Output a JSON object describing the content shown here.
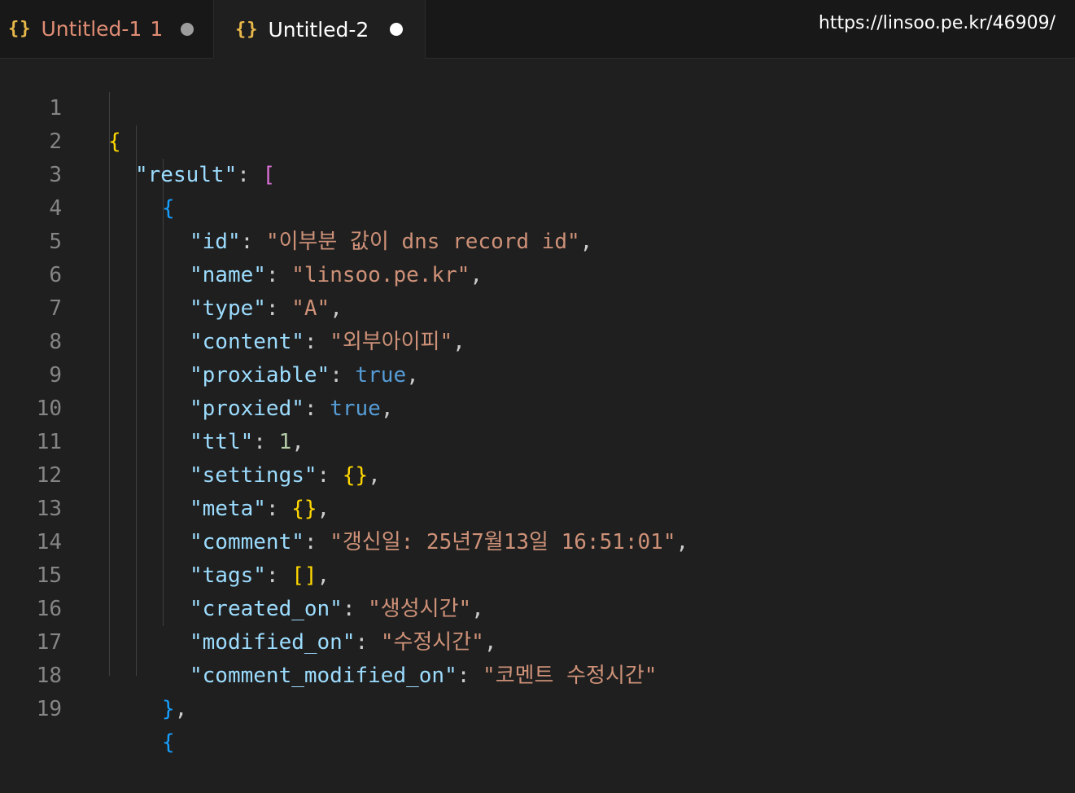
{
  "tabs": [
    {
      "icon": "{}",
      "label": "Untitled-1",
      "badge": "1"
    },
    {
      "icon": "{}",
      "label": "Untitled-2"
    }
  ],
  "watermark": "https://linsoo.pe.kr/46909/",
  "editor": {
    "line_numbers": [
      "1",
      "2",
      "3",
      "4",
      "5",
      "6",
      "7",
      "8",
      "9",
      "10",
      "11",
      "12",
      "13",
      "14",
      "15",
      "16",
      "17",
      "18",
      "19"
    ],
    "lines": {
      "l1": {
        "open": "{"
      },
      "l2": {
        "key": "\"result\"",
        "colon": ": ",
        "open": "["
      },
      "l3": {
        "open": "{"
      },
      "l4": {
        "key": "\"id\"",
        "colon": ": ",
        "value": "\"이부분 값이 dns record id\"",
        "comma": ","
      },
      "l5": {
        "key": "\"name\"",
        "colon": ": ",
        "value": "\"linsoo.pe.kr\"",
        "comma": ","
      },
      "l6": {
        "key": "\"type\"",
        "colon": ": ",
        "value": "\"A\"",
        "comma": ","
      },
      "l7": {
        "key": "\"content\"",
        "colon": ": ",
        "value": "\"외부아이피\"",
        "comma": ","
      },
      "l8": {
        "key": "\"proxiable\"",
        "colon": ": ",
        "value": "true",
        "comma": ","
      },
      "l9": {
        "key": "\"proxied\"",
        "colon": ": ",
        "value": "true",
        "comma": ","
      },
      "l10": {
        "key": "\"ttl\"",
        "colon": ": ",
        "value": "1",
        "comma": ","
      },
      "l11": {
        "key": "\"settings\"",
        "colon": ": ",
        "value": "{}",
        "comma": ","
      },
      "l12": {
        "key": "\"meta\"",
        "colon": ": ",
        "value": "{}",
        "comma": ","
      },
      "l13": {
        "key": "\"comment\"",
        "colon": ": ",
        "value": "\"갱신일: 25년7월13일 16:51:01\"",
        "comma": ","
      },
      "l14": {
        "key": "\"tags\"",
        "colon": ": ",
        "value": "[]",
        "comma": ","
      },
      "l15": {
        "key": "\"created_on\"",
        "colon": ": ",
        "value": "\"생성시간\"",
        "comma": ","
      },
      "l16": {
        "key": "\"modified_on\"",
        "colon": ": ",
        "value": "\"수정시간\"",
        "comma": ","
      },
      "l17": {
        "key": "\"comment_modified_on\"",
        "colon": ": ",
        "value": "\"코멘트 수정시간\""
      },
      "l18": {
        "close": "}",
        "comma": ","
      },
      "l19": {
        "open": "{"
      }
    }
  }
}
